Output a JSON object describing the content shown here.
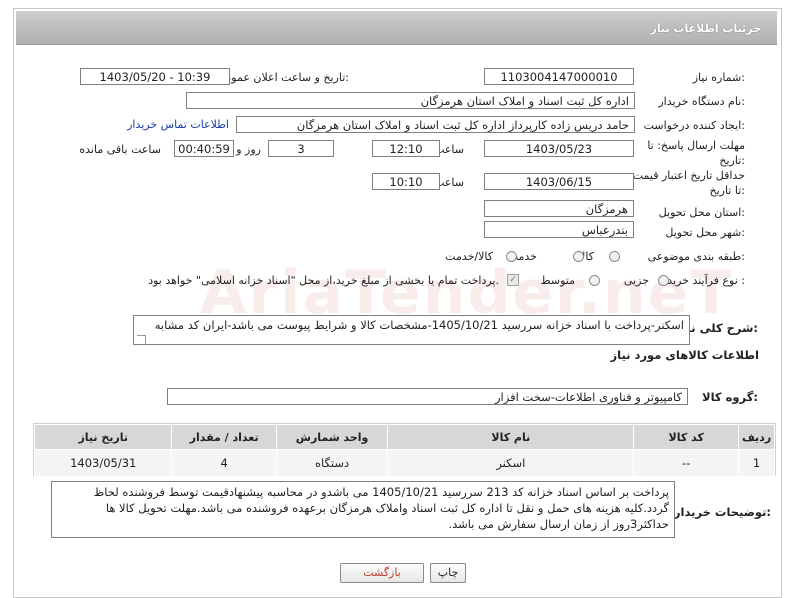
{
  "header": {
    "title": "جزئیات اطلاعات نیاز"
  },
  "need_number": {
    "label": "شماره نیاز:",
    "value": "1103004147000010"
  },
  "announce_datetime": {
    "label": "تاریخ و ساعت اعلان عمومی:",
    "value": "1403/05/20 - 10:39"
  },
  "buyer_org": {
    "label": "نام دستگاه خریدار:",
    "value": "اداره کل ثبت اسناد و املاک استان هرمزگان"
  },
  "requester": {
    "label": "ایجاد کننده درخواست:",
    "value": "حامد دریس زاده کارپرداز اداره کل ثبت اسناد و املاک استان هرمزگان",
    "contact_link": "اطلاعات تماس خریدار"
  },
  "reply_deadline": {
    "label": "مهلت ارسال پاسخ: تا تاریخ:",
    "date": "1403/05/23",
    "time_label": "ساعت",
    "time": "12:10",
    "days": "3",
    "days_label": "روز و",
    "remaining": "00:40:59",
    "remaining_label": "ساعت باقی مانده"
  },
  "price_validity": {
    "label": "حداقل تاریخ اعتبار قیمت: تا تاریخ:",
    "date": "1403/06/15",
    "time_label": "ساعت",
    "time": "10:10"
  },
  "province": {
    "label": "استان محل تحویل:",
    "value": "هرمزگان"
  },
  "city": {
    "label": "شهر محل تحویل:",
    "value": "بندرعباس"
  },
  "category": {
    "label": "طبقه بندی موضوعی:",
    "options": [
      "کالا",
      "خدمت",
      "کالا/خدمت"
    ]
  },
  "purchase_process": {
    "label": "نوع فرآیند خرید :",
    "options": [
      "جزیی",
      "متوسط"
    ],
    "payment_note": "پرداخت تمام یا بخشی از مبلغ خرید،از محل \"اسناد خزانه اسلامی\" خواهد بود."
  },
  "general_desc": {
    "label": "شرح کلی نیاز:",
    "value": "اسکنر-پرداخت با اسناد خزانه سررسید 1405/10/21-مشخصات کالا و شرایط پیوست می باشد-ایران کد مشابه"
  },
  "goods_section_title": "اطلاعات کالاهای مورد نیاز",
  "goods_group": {
    "label": "گروه کالا:",
    "value": "کامپیوتر و فناوری اطلاعات-سخت افزار"
  },
  "table": {
    "headers": [
      "ردیف",
      "کد کالا",
      "نام کالا",
      "واحد شمارش",
      "تعداد / مقدار",
      "تاریخ نیاز"
    ],
    "rows": [
      [
        "1",
        "--",
        "اسکنر",
        "دستگاه",
        "4",
        "1403/05/31"
      ]
    ]
  },
  "buyer_notes": {
    "label": "توضیحات خریدار:",
    "value": "پرداخت بر اساس اسناد خزانه کد 213 سررسید 1405/10/21 می باشدو در محاسبه پیشنهادقیمت توسط فروشنده لحاظ گردد.کلیه هزینه های حمل و نقل تا اداره کل ثبت اسناد واملاک هرمزگان برعهده فروشنده می باشد.مهلت تحویل کالا ها حداکثر3روز از زمان ارسال سفارش می باشد."
  },
  "buttons": {
    "print": "چاپ",
    "back": "بازگشت"
  },
  "watermark": "AriaTender.neT"
}
